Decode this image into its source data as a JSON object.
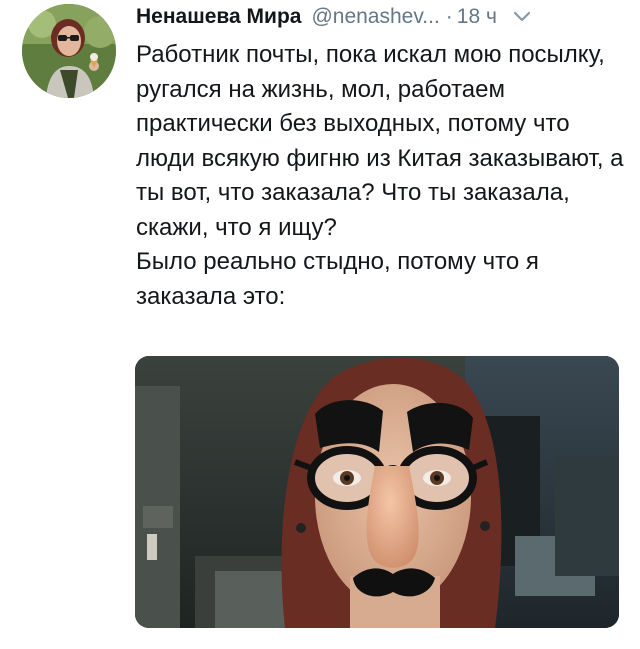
{
  "tweet": {
    "author_name": "Ненашева Мира",
    "handle": "@nenashev...",
    "separator": "·",
    "time": "18 ч",
    "text_paragraphs": [
      "Работник почты, пока искал мою посылку, ругался на жизнь, мол, работаем практически без выходных, потому что люди всякую фигню из Китая заказывают, а ты вот, что заказала? Что ты заказала, скажи, что я ищу?",
      "Было реально стыдно, потому что я заказала это:"
    ],
    "avatar_icon": "profile-photo-woman-with-sunglasses",
    "menu_icon": "chevron-down-icon",
    "media_icon": "photo-woman-wearing-groucho-glasses"
  },
  "colors": {
    "text_primary": "#14171a",
    "text_secondary": "#657786",
    "chevron": "#8899a6",
    "background": "#ffffff"
  }
}
